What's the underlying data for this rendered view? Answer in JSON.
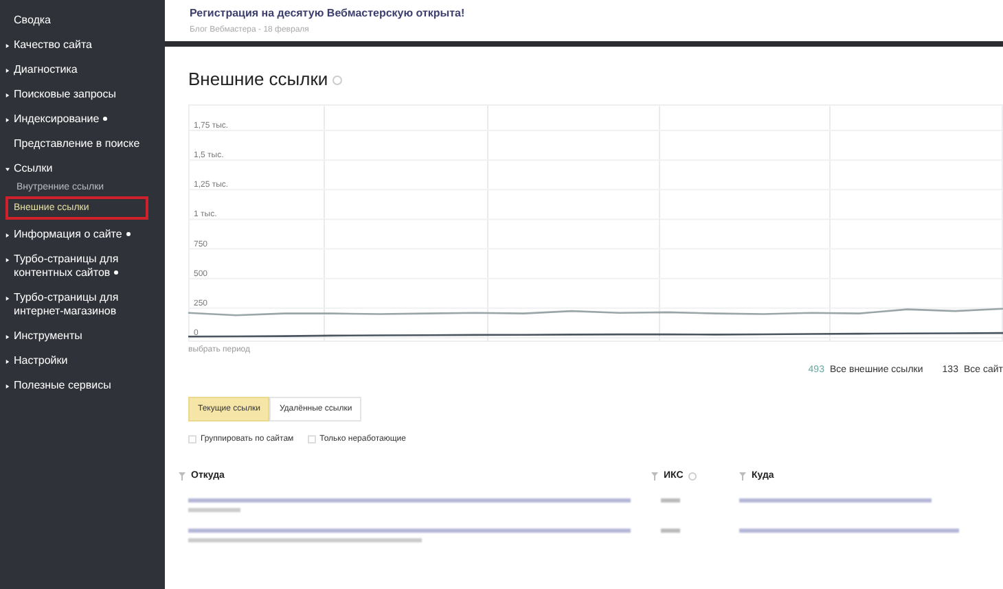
{
  "sidebar": {
    "items": [
      {
        "label": "Сводка",
        "kind": "link",
        "dot": false
      },
      {
        "label": "Качество сайта",
        "kind": "group",
        "expanded": false,
        "dot": false
      },
      {
        "label": "Диагностика",
        "kind": "group",
        "expanded": false,
        "dot": false
      },
      {
        "label": "Поисковые запросы",
        "kind": "group",
        "expanded": false,
        "dot": false
      },
      {
        "label": "Индексирование",
        "kind": "group",
        "expanded": false,
        "dot": true
      },
      {
        "label": "Представление в поиске",
        "kind": "link",
        "dot": false
      },
      {
        "label": "Ссылки",
        "kind": "group",
        "expanded": true,
        "dot": false,
        "children": [
          {
            "label": "Внутренние ссылки",
            "selected": false
          },
          {
            "label": "Внешние ссылки",
            "selected": true
          }
        ]
      },
      {
        "label": "Информация о сайте",
        "kind": "group",
        "expanded": false,
        "dot": true
      },
      {
        "label": "Турбо-страницы для контентных сайтов",
        "kind": "group",
        "expanded": false,
        "dot": true
      },
      {
        "label": "Турбо-страницы для интернет-магазинов",
        "kind": "group",
        "expanded": false,
        "dot": false
      },
      {
        "label": "Инструменты",
        "kind": "group",
        "expanded": false,
        "dot": false
      },
      {
        "label": "Настройки",
        "kind": "group",
        "expanded": false,
        "dot": false
      },
      {
        "label": "Полезные сервисы",
        "kind": "group",
        "expanded": false,
        "dot": false
      }
    ]
  },
  "banner": {
    "title": "Регистрация на десятую Вебмастерскую открыта!",
    "subtitle": "Блог Вебмастера - 18 февраля"
  },
  "page_title": "Внешние ссылки",
  "chart": {
    "period_link": "выбрать период",
    "y_axis_labels": [
      "1,75 тыс.",
      "1,5 тыс.",
      "1,25 тыс.",
      "1 тыс.",
      "750",
      "500",
      "250",
      "0"
    ]
  },
  "legend": [
    {
      "count": "493",
      "label": "Все внешние ссылки",
      "color": "#6aa8a0"
    },
    {
      "count": "133",
      "label": "Все сайт",
      "color": "#333333"
    }
  ],
  "tabs": [
    {
      "label": "Текущие ссылки",
      "selected": true
    },
    {
      "label": "Удалённые ссылки",
      "selected": false
    }
  ],
  "filters": [
    {
      "label": "Группировать по сайтам",
      "checked": false
    },
    {
      "label": "Только неработающие",
      "checked": false
    }
  ],
  "table": {
    "columns": [
      "Откуда",
      "ИКС",
      "Куда"
    ]
  }
}
